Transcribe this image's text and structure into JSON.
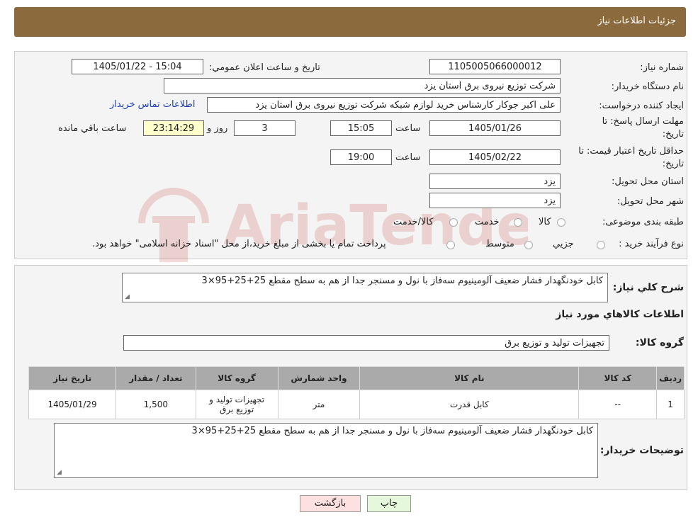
{
  "header": {
    "title": "جزئيات اطلاعات نياز"
  },
  "fields": {
    "need_number_label": "شماره نياز:",
    "need_number": "1105005066000012",
    "announce_label": "تاريخ و ساعت اعلان عمومي:",
    "announce_value": "1405/01/22 - 15:04",
    "buyer_org_label": "نام دستگاه خريدار:",
    "buyer_org": "شرکت توزيع نيروی برق استان يزد",
    "creator_label": "ايجاد کننده درخواست:",
    "creator": "علی اکبر  جوکار  کارشناس خرید لوازم شبکه  شرکت توزيع نيروی برق استان يزد",
    "contact_link": "اطلاعات تماس خريدار",
    "deadline_label_1": "مهلت ارسال پاسخ: تا",
    "deadline_label_2": "تاريخ:",
    "deadline_date": "1405/01/26",
    "time_label": "ساعت",
    "deadline_time": "15:05",
    "days_value": "3",
    "days_label": "روز و",
    "remaining_time": "23:14:29",
    "remaining_label": "ساعت باقي مانده",
    "validity_label_1": "حداقل تاريخ اعتبار قيمت: تا",
    "validity_label_2": "تاريخ:",
    "validity_date": "1405/02/22",
    "validity_time": "19:00",
    "province_label": "استان محل تحويل:",
    "province": "يزد",
    "city_label": "شهر محل تحويل:",
    "city": "يزد",
    "category_label": "طبقه بندی موضوعی:",
    "category_options": [
      "کالا",
      "خدمت",
      "کالا/خدمت"
    ],
    "process_label": "نوع فرآيند خريد :",
    "process_options": [
      "جزيي",
      "متوسط"
    ],
    "process_note": "پرداخت تمام يا بخشی از مبلغ خريد،از محل \"اسناد خزانه اسلامی\" خواهد بود."
  },
  "summary": {
    "description_label": "شرح کلي نياز:",
    "description": "کابل خودنگهدار فشار ضعیف آلومینیوم سه‌فاز با نول و مسنجر جدا از هم به سطح مقطع 25+25+95×3",
    "goods_info_title": "اطلاعات کالاهاي مورد نياز",
    "goods_group_label": "گروه کالا:",
    "goods_group": "تجهيزات توليد و توزيع برق"
  },
  "table": {
    "headers": [
      "رديف",
      "کد کالا",
      "نام کالا",
      "واحد شمارش",
      "گروه کالا",
      "تعداد / مقدار",
      "تاريخ نياز"
    ],
    "rows": [
      [
        "1",
        "--",
        "کابل قدرت",
        "متر",
        "تجهيزات توليد و توزيع برق",
        "1,500",
        "1405/01/29"
      ]
    ]
  },
  "buyer_notes": {
    "label": "توضيحات خريدار:",
    "text": "کابل خودنگهدار فشار ضعیف آلومینیوم سه‌فاز با نول و مسنجر جدا از هم به سطح مقطع 25+25+95×3"
  },
  "buttons": {
    "print": "چاپ",
    "back": "بازگشت"
  },
  "watermark": {
    "text": "AriaTender.neT"
  },
  "colors": {
    "header": "#8b6b3e",
    "print_button": "#e6f8dc",
    "back_button": "#fde0e0",
    "remaining": "#ffffcc"
  }
}
